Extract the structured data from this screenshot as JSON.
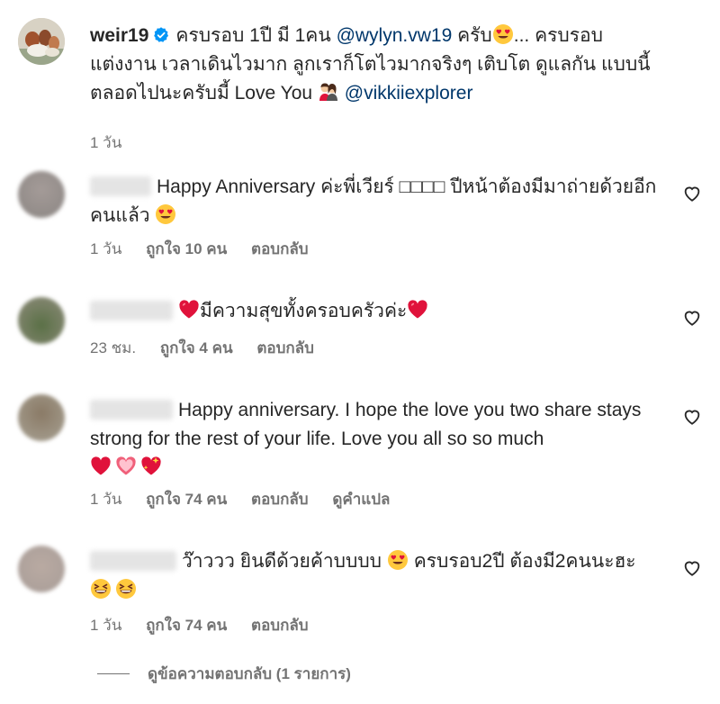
{
  "post": {
    "username": "weir19",
    "caption_part1": "ครบรอบ 1ปี มี 1คน",
    "mention1": "@wylyn.vw19",
    "caption_part2": "ครับ",
    "caption_part3": "... ครบรอบ แต่งงาน เวลาเดินไวมาก ลูกเราก็โตไวมากจริงๆ เติบโต ดูแลกัน แบบนี้ตลอดไปนะครับมี้ Love You",
    "mention2": "@vikkiiexplorer",
    "time": "1 วัน"
  },
  "comments": [
    {
      "text": "Happy Anniversary ค่ะพี่เวียร์ □□□□ ปีหน้าต้องมีมาถ่ายด้วยอีกคนแล้ว",
      "time": "1 วัน",
      "likes": "ถูกใจ 10 คน",
      "reply": "ตอบกลับ",
      "translate": ""
    },
    {
      "text": "มีความสุขทั้งครอบครัวค่ะ",
      "time": "23 ชม.",
      "likes": "ถูกใจ 4 คน",
      "reply": "ตอบกลับ",
      "translate": ""
    },
    {
      "text": "Happy anniversary. I hope the love you two share stays strong for the rest of your life. Love you all so so much",
      "time": "1 วัน",
      "likes": "ถูกใจ 74 คน",
      "reply": "ตอบกลับ",
      "translate": "ดูคำแปล"
    },
    {
      "text": "ว๊าววว ยินดีด้วยค้าบบบบ",
      "text2": "ครบรอบ2ปี ต้องมี2คนนะฮะ",
      "time": "1 วัน",
      "likes": "ถูกใจ 74 คน",
      "reply": "ตอบกลับ",
      "translate": ""
    }
  ],
  "view_replies": "ดูข้อความตอบกลับ (1 รายการ)",
  "colors": {
    "text": "#262626",
    "secondary": "#737373",
    "mention": "#00376b",
    "verified": "#0095f6",
    "heart_red": "#e0123b"
  },
  "icons": [
    "verified-badge-icon",
    "heart-eyes-emoji",
    "couple-emoji",
    "red-heart-emoji",
    "pink-heart-emoji",
    "sparkling-heart-emoji",
    "grinning-squint-emoji",
    "heart-outline-icon"
  ]
}
